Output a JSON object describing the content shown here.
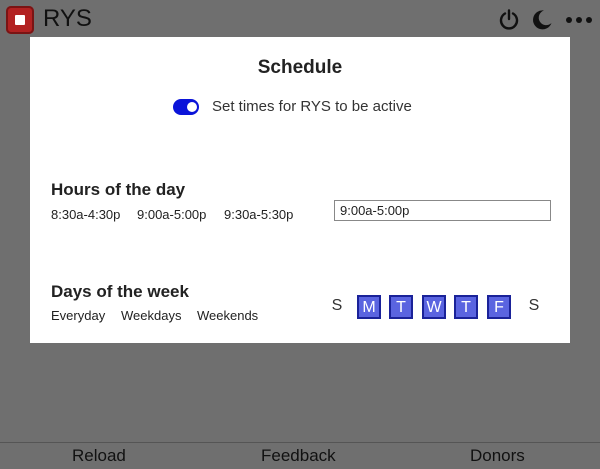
{
  "header": {
    "app_title": "RYS",
    "icons": [
      "power-icon",
      "moon-icon",
      "more-icon"
    ]
  },
  "modal": {
    "title": "Schedule",
    "toggle_label": "Set times for RYS to be active",
    "toggle_on": true,
    "hours": {
      "title": "Hours of the day",
      "presets": [
        "8:30a-4:30p",
        "9:00a-5:00p",
        "9:30a-5:30p"
      ],
      "input_value": "9:00a-5:00p"
    },
    "days": {
      "title": "Days of the week",
      "presets": [
        "Everyday",
        "Weekdays",
        "Weekends"
      ],
      "list": [
        {
          "label": "S",
          "active": false
        },
        {
          "label": "M",
          "active": true
        },
        {
          "label": "T",
          "active": true
        },
        {
          "label": "W",
          "active": true
        },
        {
          "label": "T",
          "active": true
        },
        {
          "label": "F",
          "active": true
        },
        {
          "label": "S",
          "active": false
        }
      ]
    }
  },
  "footer": {
    "reload": "Reload",
    "feedback": "Feedback",
    "donors": "Donors"
  },
  "colors": {
    "overlay": "#6f6f6f",
    "accent": "#0b14d9",
    "day_active_fill": "#5a64e0",
    "day_active_border": "#1a2299",
    "logo": "#b22222"
  }
}
